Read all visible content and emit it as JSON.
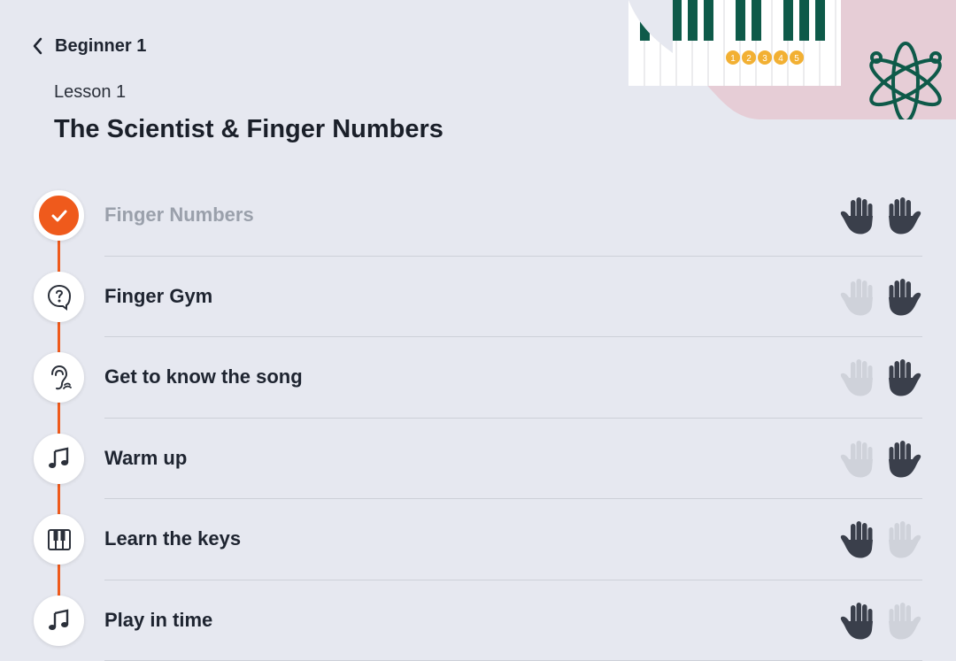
{
  "nav": {
    "back_label": "Beginner 1"
  },
  "lesson": {
    "kicker": "Lesson 1",
    "title": "The Scientist & Finger Numbers"
  },
  "art": {
    "finger_numbers": [
      "1",
      "2",
      "3",
      "4",
      "5"
    ]
  },
  "colors": {
    "accent": "#ef5a1c",
    "hand_active": "#3a3f4b",
    "hand_inactive": "#cfd2da",
    "art_green": "#0e5a49",
    "art_pink": "#e6cdd6"
  },
  "steps": [
    {
      "label": "Finger Numbers",
      "icon": "check-icon",
      "completed": true,
      "left_hand": true,
      "right_hand": true
    },
    {
      "label": "Finger Gym",
      "icon": "question-bubble-icon",
      "completed": false,
      "left_hand": false,
      "right_hand": true
    },
    {
      "label": "Get to know the song",
      "icon": "ear-icon",
      "completed": false,
      "left_hand": false,
      "right_hand": true
    },
    {
      "label": "Warm up",
      "icon": "music-note-icon",
      "completed": false,
      "left_hand": false,
      "right_hand": true
    },
    {
      "label": "Learn the keys",
      "icon": "piano-keys-icon",
      "completed": false,
      "left_hand": true,
      "right_hand": false
    },
    {
      "label": "Play in time",
      "icon": "music-note-icon",
      "completed": false,
      "left_hand": true,
      "right_hand": false
    }
  ]
}
